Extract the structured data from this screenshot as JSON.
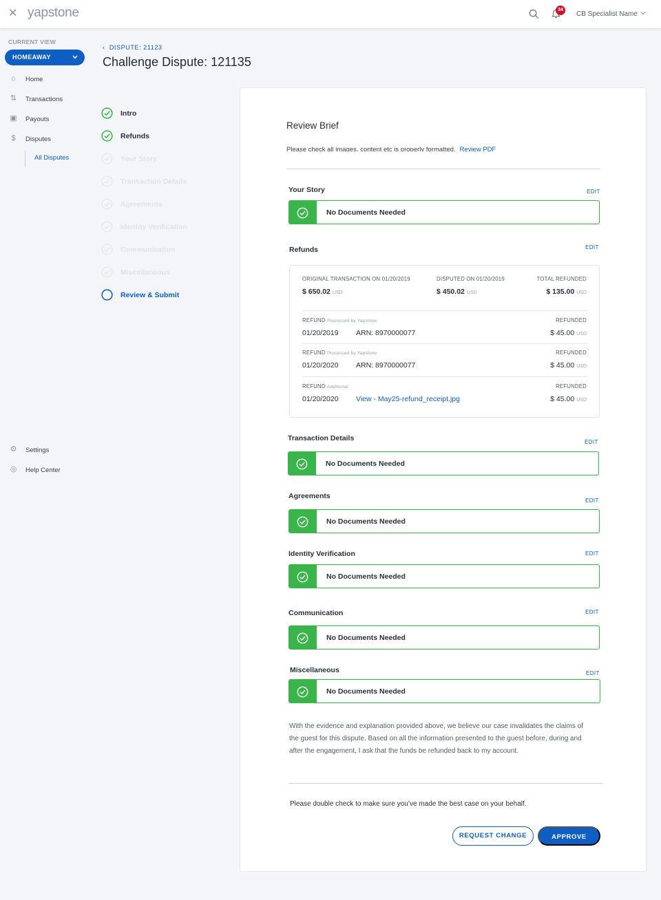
{
  "app": {
    "logo_text": "yapstone",
    "user_name": "CB Specialist Name",
    "notification_count": "34",
    "icons": [
      "close-icon",
      "search-icon",
      "bell-icon",
      "chevron-down-icon"
    ]
  },
  "sidebar": {
    "current_view_label": "CURRENT VIEW",
    "current_view_value": "HOMEAWAY",
    "items": [
      {
        "label": "Home",
        "icon": "home-icon"
      },
      {
        "label": "Transactions",
        "icon": "transactions-icon"
      },
      {
        "label": "Payouts",
        "icon": "payouts-icon"
      },
      {
        "label": "Disputes",
        "icon": "disputes-icon"
      }
    ],
    "sub_item": "All Disputes",
    "bottom_items": [
      {
        "label": "Settings",
        "icon": "gear-icon"
      },
      {
        "label": "Help Center",
        "icon": "help-icon"
      }
    ]
  },
  "page": {
    "breadcrumb": "DISPUTE: 21123",
    "title": "Challenge Dispute: 121135"
  },
  "steps": [
    {
      "label": "Intro",
      "state": "done"
    },
    {
      "label": "Refunds",
      "state": "done"
    },
    {
      "label": "Your Story",
      "state": "todo"
    },
    {
      "label": "Transaction Details",
      "state": "todo"
    },
    {
      "label": "Agreements",
      "state": "todo"
    },
    {
      "label": "Identity Verification",
      "state": "todo"
    },
    {
      "label": "Communication",
      "state": "todo"
    },
    {
      "label": "Miscellaneous",
      "state": "todo"
    },
    {
      "label": "Review & Submit",
      "state": "active"
    }
  ],
  "review": {
    "title": "Review Brief",
    "note": "Please check all images, content etc is properly formatted.",
    "note_link": "Review PDF",
    "edit_label": "EDIT",
    "no_docs": "No Documents Needed",
    "sections": {
      "your_story": "Your Story",
      "refunds": "Refunds",
      "transaction_details": "Transaction Details",
      "agreements": "Agreements",
      "identity_verification": "Identity Verification",
      "communication": "Communication",
      "miscellaneous": "Miscellaneous"
    },
    "refunds": {
      "original_label": "ORIGINAL TRANSACTION ON 01/20/2019",
      "original_amount": "$ 650.02",
      "disputed_label": "DISPUTED ON 01/20/2019",
      "disputed_amount": "$ 450.02",
      "total_label": "TOTAL REFUNDED",
      "total_amount": "$ 135.00",
      "currency": "USD",
      "refunded_label": "REFUNDED",
      "rows": [
        {
          "label": "REFUND",
          "sub": "Processed by Yapstone",
          "date": "01/20/2019",
          "ref": "ARN: 8970000077",
          "amount": "$ 45.00"
        },
        {
          "label": "REFUND",
          "sub": "Processed by Yapstone",
          "date": "01/20/2020",
          "ref": "ARN: 8970000077",
          "amount": "$ 45.00"
        },
        {
          "label": "REFUND",
          "sub": "Additional",
          "date": "01/20/2020",
          "ref": "View - May25-refund_receipt.jpg",
          "amount": "$ 45.00"
        }
      ]
    },
    "closing": "With the evidence and explanation provided above, we believe our case invalidates the claims of the guest for this dispute. Based on all the information presented to the guest before, during and after the engagement, I ask that the funds be refunded back to my account.",
    "double_check": "Please double check to make sure you’ve made the best case on your behalf.",
    "request_change": "REQUEST CHANGE",
    "approve": "APPROVE"
  },
  "colors": {
    "primary": "#0e5ec4",
    "success": "#39b54a",
    "badge": "#d0112b"
  }
}
